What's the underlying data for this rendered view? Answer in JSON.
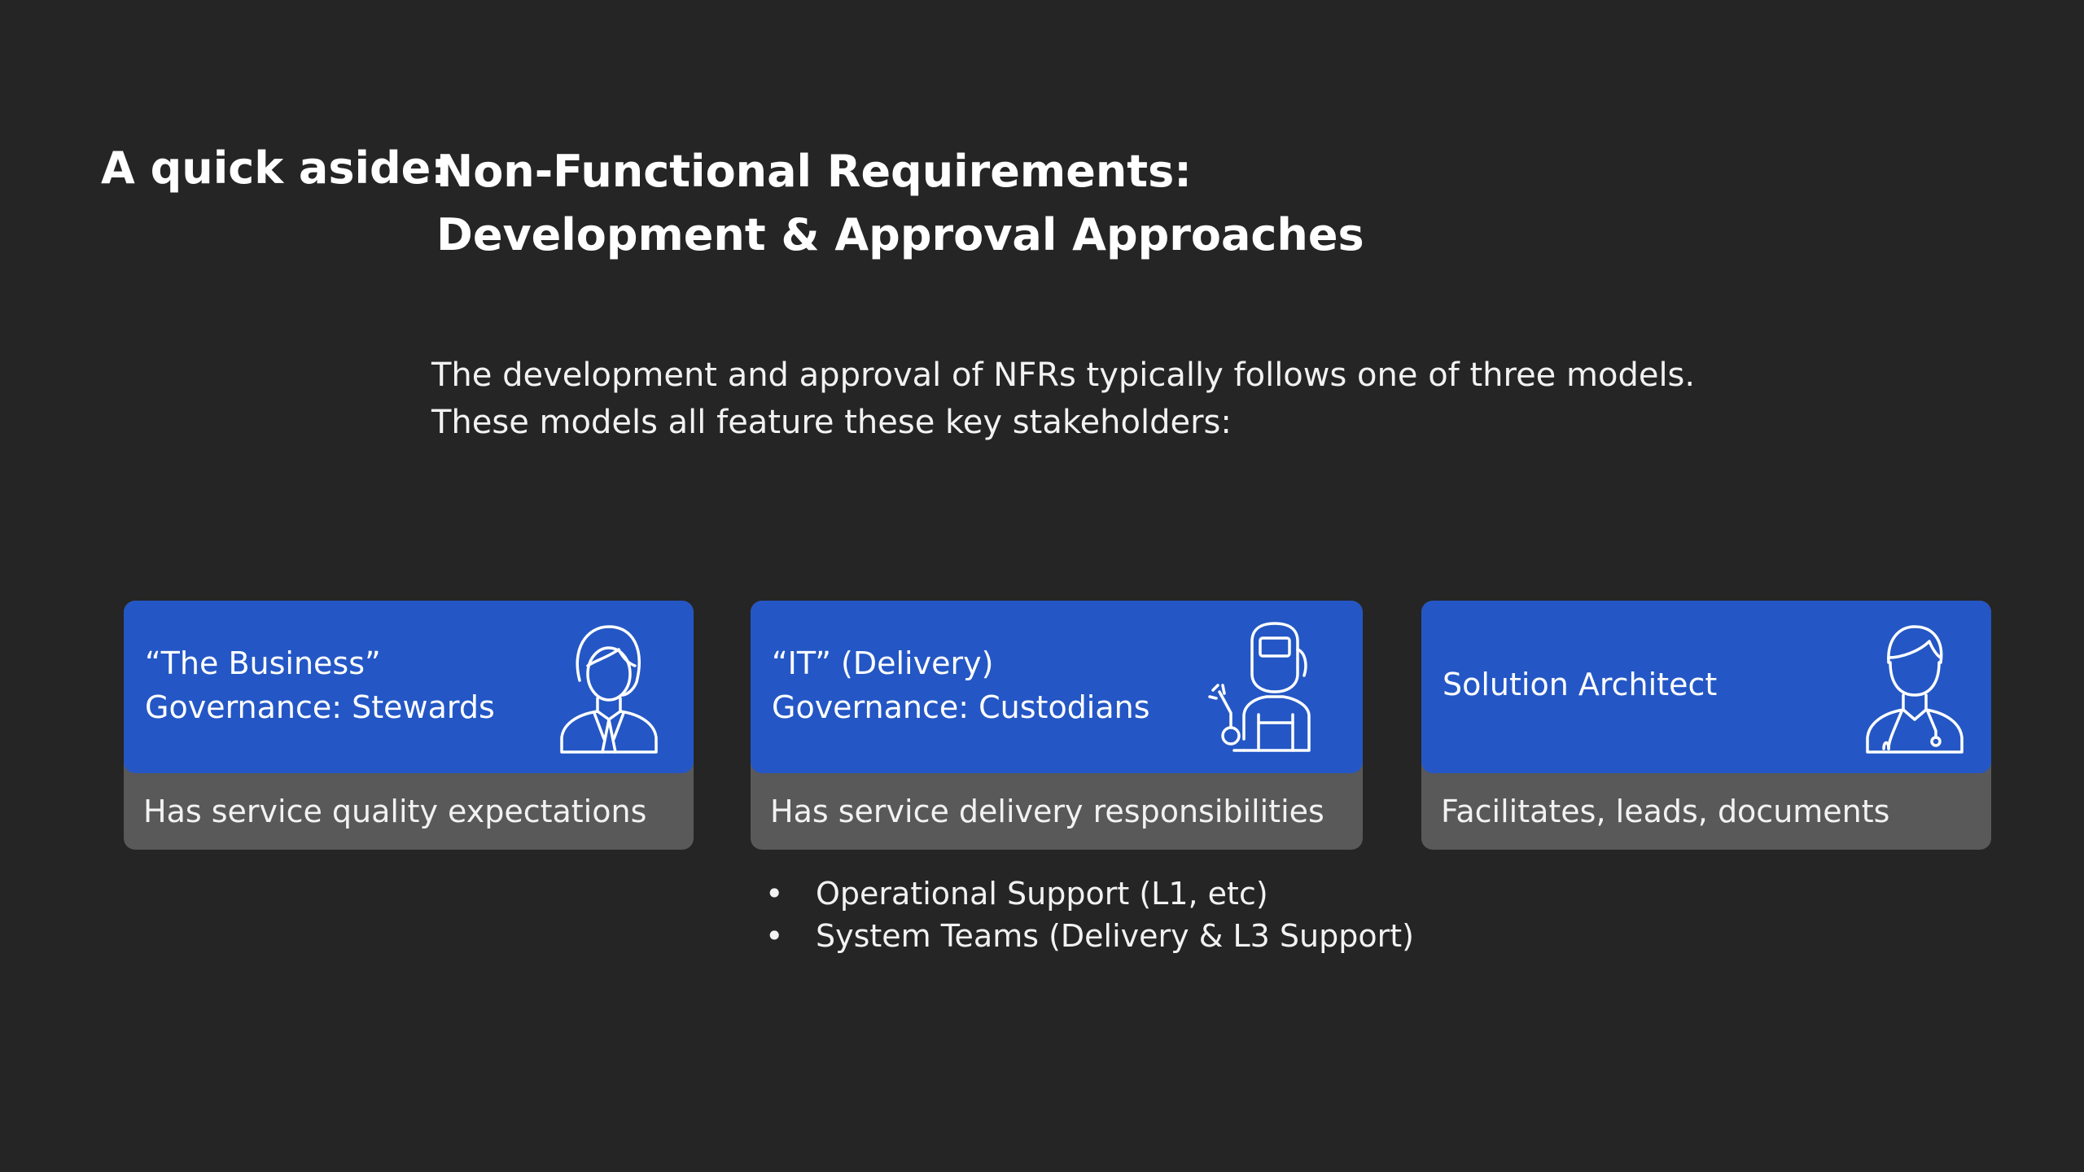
{
  "title": {
    "prefix": "A quick aside:",
    "line1": "Non-Functional Requirements:",
    "line2": "Development & Approval Approaches"
  },
  "intro": {
    "line1": "The development and approval of NFRs typically follows one of three models.",
    "line2": "These models all feature these key stakeholders:"
  },
  "cards": [
    {
      "title": "“The Business”",
      "subtitle": "Governance: Stewards",
      "description": "Has service quality expectations",
      "icon": "businesswoman-icon"
    },
    {
      "title": "“IT” (Delivery)",
      "subtitle": "Governance: Custodians",
      "description": "Has service delivery responsibilities",
      "icon": "welder-worker-icon"
    },
    {
      "title": "Solution Architect",
      "description": "Facilitates, leads, documents",
      "icon": "doctor-stethoscope-icon"
    }
  ],
  "bullets": {
    "marker": "•",
    "items": [
      "Operational Support (L1, etc)",
      "System Teams (Delivery & L3 Support)"
    ]
  },
  "colors": {
    "background": "#252525",
    "card_header": "#2457c5",
    "card_body": "#595959",
    "text": "#ffffff"
  }
}
